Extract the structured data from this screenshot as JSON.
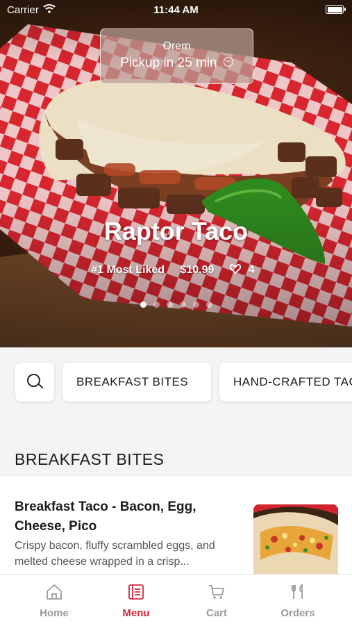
{
  "status_bar": {
    "carrier": "Carrier",
    "time": "11:44 AM"
  },
  "pickup": {
    "location": "Orem",
    "label": "Pickup in 25 min"
  },
  "hero": {
    "title": "Raptor Taco",
    "badge": "#1 Most Liked",
    "price": "$10.99",
    "likes": "4",
    "carousel_count": 6,
    "carousel_active": 0
  },
  "categories": [
    "BREAKFAST BITES",
    "HAND-CRAFTED TACOS"
  ],
  "section": {
    "title": "BREAKFAST BITES",
    "items": [
      {
        "name": "Breakfast Taco - Bacon, Egg, Cheese, Pico",
        "description": "Crispy bacon, fluffy scrambled eggs, and melted cheese wrapped in a crisp..."
      }
    ]
  },
  "tab_bar": {
    "items": [
      {
        "label": "Home",
        "icon": "home-icon"
      },
      {
        "label": "Menu",
        "icon": "menu-book-icon"
      },
      {
        "label": "Cart",
        "icon": "cart-icon"
      },
      {
        "label": "Orders",
        "icon": "fork-knife-icon"
      }
    ],
    "active": 1
  },
  "colors": {
    "accent": "#d3293f",
    "inactive": "#9a9a9a",
    "background": "#f4f4f4"
  }
}
